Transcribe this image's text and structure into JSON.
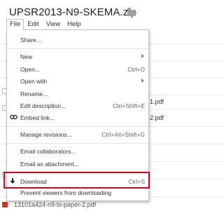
{
  "document": {
    "title": "UPSR2013-N9-SKEMA.zip",
    "star_icon": "star-icon",
    "folder_icon": "folder-icon"
  },
  "menubar": [
    "File",
    "Edit",
    "View",
    "Help"
  ],
  "file_menu": {
    "share": "Share...",
    "new": "New",
    "open": "Open...",
    "open_shortcut": "Ctrl+O",
    "open_with": "Open with",
    "rename": "Rename...",
    "edit_description": "Edit description...",
    "edit_description_shortcut": "Ctrl+Shift+E",
    "embed_link": "Embed link...",
    "manage_revisions": "Manage revisions...",
    "manage_revisions_shortcut": "Ctrl+Alt+Shift+G",
    "email_collaborators": "Email collaborators...",
    "email_attachment": "Email as attachment...",
    "download": "Download",
    "download_shortcut": "Ctrl+S",
    "prevent_download": "Prevent viewers from downloading"
  },
  "background_files": {
    "row_a": "1.pdf",
    "row_b": "2.pdf",
    "row_bottom": "13101a424-n9-bi-paper-2.pdf"
  },
  "colors": {
    "highlight": "#e0001b"
  }
}
